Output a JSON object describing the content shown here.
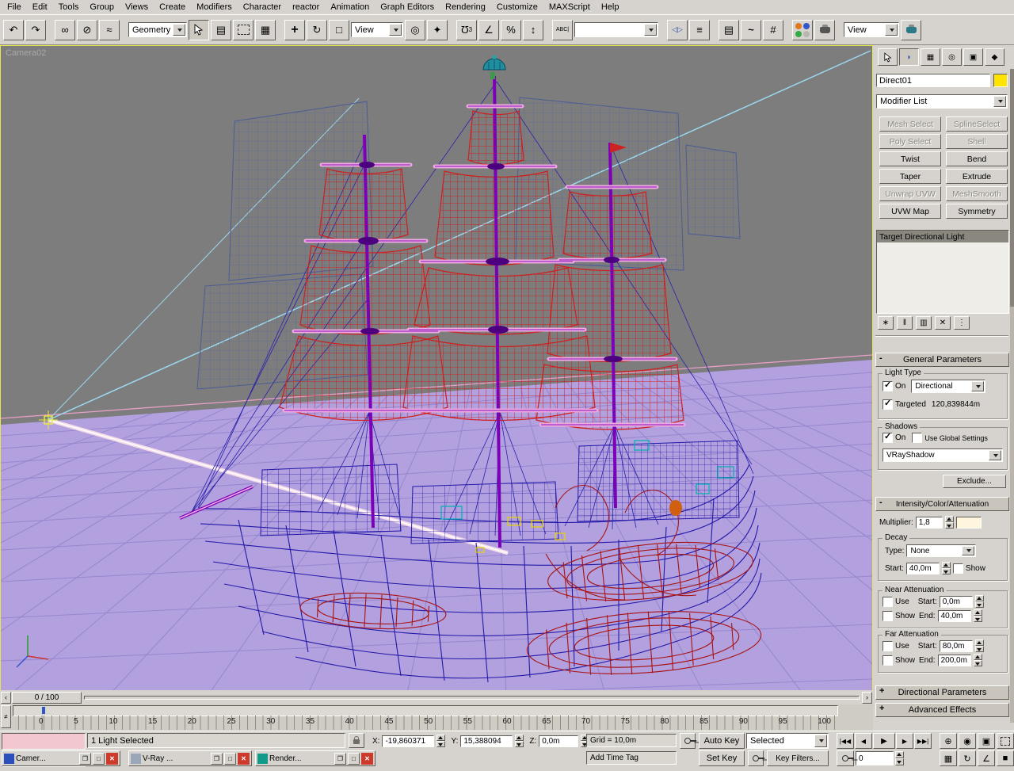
{
  "menu": {
    "items": [
      "File",
      "Edit",
      "Tools",
      "Group",
      "Views",
      "Create",
      "Modifiers",
      "Character",
      "reactor",
      "Animation",
      "Graph Editors",
      "Rendering",
      "Customize",
      "MAXScript",
      "Help"
    ]
  },
  "toolbar": {
    "selection_filter": "Geometry",
    "ref_coord": "View",
    "named_sets": "",
    "render_view": "View"
  },
  "viewport": {
    "camera_label": "Camera02"
  },
  "panel": {
    "object_name": "Direct01",
    "modifier_list": "Modifier List",
    "buttons": [
      "Mesh Select",
      "SplineSelect",
      "Poly Select",
      "Shell",
      "Twist",
      "Bend",
      "Taper",
      "Extrude",
      "Unwrap UVW",
      "MeshSmooth",
      "UVW Map",
      "Symmetry"
    ],
    "stack_selected": "Target Directional Light",
    "general": {
      "sign": "-",
      "title": "General Parameters",
      "light_type": "Light Type",
      "on": "On",
      "type": "Directional",
      "targeted": "Targeted",
      "distance": "120,839844m",
      "shadows": "Shadows",
      "shadow_on": "On",
      "use_global": "Use Global Settings",
      "shadow_plugin": "VRayShadow",
      "exclude": "Exclude..."
    },
    "intensity": {
      "sign": "-",
      "title": "Intensity/Color/Attenuation",
      "multiplier": "Multiplier:",
      "multiplier_value": "1,8",
      "decay": "Decay",
      "type_label": "Type:",
      "type_value": "None",
      "start_label": "Start:",
      "decay_start": "40,0m",
      "show": "Show",
      "near": "Near Attenuation",
      "use": "Use",
      "near_start": "0,0m",
      "end_label": "End:",
      "near_end": "40,0m",
      "far": "Far Attenuation",
      "far_start": "80,0m",
      "far_end": "200,0m"
    },
    "directional": {
      "sign": "+",
      "title": "Directional Parameters"
    },
    "advanced": {
      "sign": "+",
      "title": "Advanced Effects"
    }
  },
  "timeline": {
    "slider": "0 / 100",
    "ticks": [
      "0",
      "5",
      "10",
      "15",
      "20",
      "25",
      "30",
      "35",
      "40",
      "45",
      "50",
      "55",
      "60",
      "65",
      "70",
      "75",
      "80",
      "85",
      "90",
      "95",
      "100"
    ]
  },
  "status": {
    "selection": "1 Light Selected",
    "x_label": "X:",
    "x": "-19,860371",
    "y_label": "Y:",
    "y": "15,388094",
    "z_label": "Z:",
    "z": "0,0m",
    "grid": "Grid = 10,0m",
    "add_time_tag": "Add Time Tag",
    "auto_key": "Auto Key",
    "set_key": "Set Key",
    "selected_dd": "Selected",
    "key_filters": "Key Filters...",
    "frame": "0"
  },
  "windows": [
    {
      "title": "Camer..."
    },
    {
      "title": "V-Ray ..."
    },
    {
      "title": "Render..."
    }
  ],
  "colors": {
    "object_color": "#ffe400",
    "light_color": "#fff6dd",
    "active_viewport_border": "#e6e64e",
    "ground": "#b2a0df",
    "sail_red": "#cf1f1f",
    "wire_blue": "#2419a8"
  }
}
